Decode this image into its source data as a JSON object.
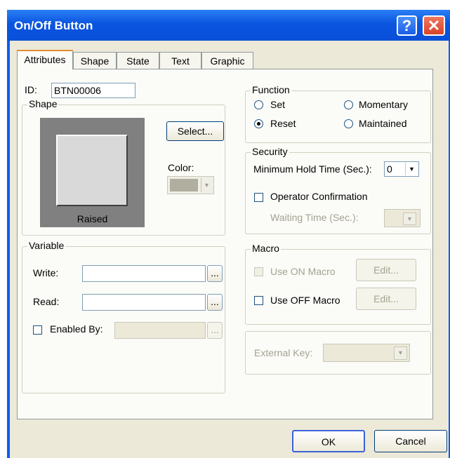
{
  "window": {
    "title": "On/Off Button",
    "help_glyph": "?",
    "close_glyph": "✕"
  },
  "tabs": [
    {
      "label": "Attributes"
    },
    {
      "label": "Shape"
    },
    {
      "label": "State"
    },
    {
      "label": "Text"
    },
    {
      "label": "Graphic"
    }
  ],
  "attributes": {
    "id_label": "ID:",
    "id_value": "BTN00006",
    "shape": {
      "group_label": "Shape",
      "preview_caption": "Raised",
      "select_button": "Select...",
      "color_label": "Color:"
    },
    "variable": {
      "group_label": "Variable",
      "write_label": "Write:",
      "write_value": "",
      "read_label": "Read:",
      "read_value": "",
      "browse_label": "...",
      "enabled_by_label": "Enabled By:",
      "enabled_by_value": ""
    },
    "function": {
      "group_label": "Function",
      "options": {
        "set": "Set",
        "momentary": "Momentary",
        "reset": "Reset",
        "maintained": "Maintained"
      },
      "selected": "Reset"
    },
    "security": {
      "group_label": "Security",
      "hold_time_label": "Minimum Hold Time (Sec.):",
      "hold_time_value": "0",
      "operator_confirmation_label": "Operator Confirmation",
      "waiting_time_label": "Waiting Time (Sec.):"
    },
    "macro": {
      "group_label": "Macro",
      "use_on_label": "Use ON Macro",
      "use_off_label": "Use OFF Macro",
      "edit_label": "Edit..."
    },
    "external_key_label": "External Key:"
  },
  "footer": {
    "ok_label": "OK",
    "cancel_label": "Cancel"
  }
}
